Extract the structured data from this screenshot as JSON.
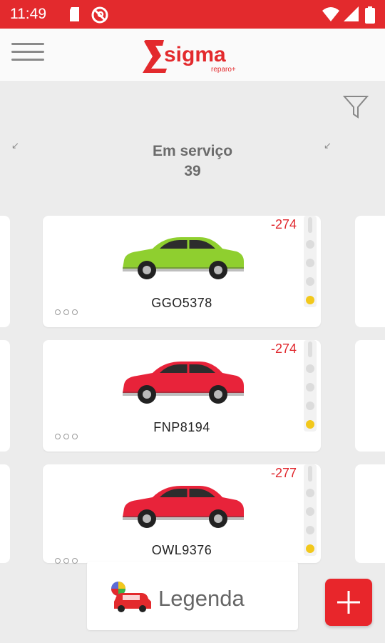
{
  "status_bar": {
    "time": "11:49",
    "icons": [
      "sd-card-icon",
      "no-disturb-icon",
      "wifi-icon",
      "signal-icon",
      "battery-icon"
    ]
  },
  "header": {
    "menu_icon": "hamburger-menu-icon",
    "logo_text": "sigma",
    "logo_subtext": "reparo+",
    "brand_color": "#e32a2d"
  },
  "filter": {
    "icon": "filter-icon"
  },
  "column": {
    "title": "Em serviço",
    "count": "39"
  },
  "cards": [
    {
      "plate": "GGO5378",
      "days": "-274",
      "car_color": "#8fcf2f",
      "active_light": 3
    },
    {
      "plate": "FNP8194",
      "days": "-274",
      "car_color": "#e8233a",
      "active_light": 3
    },
    {
      "plate": "OWL9376",
      "days": "-277",
      "car_color": "#e8233a",
      "active_light": 3
    }
  ],
  "legend": {
    "label": "Legenda",
    "icon": "car-legend-icon"
  },
  "fab": {
    "icon": "plus-icon"
  },
  "colors": {
    "light_active": "#f2c81c",
    "light_inactive": "#dcdcdc",
    "days_color": "#e0262c"
  }
}
